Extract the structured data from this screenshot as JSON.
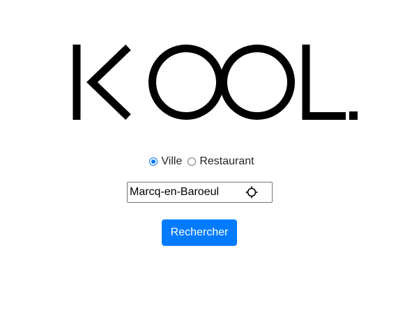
{
  "logo": {
    "text": "KOOL.",
    "color": "#000000"
  },
  "search_type": {
    "options": [
      {
        "label": "Ville",
        "checked": true
      },
      {
        "label": "Restaurant",
        "checked": false
      }
    ]
  },
  "search": {
    "value": "Marcq-en-Baroeul",
    "icon": "crosshair-locate-icon"
  },
  "submit": {
    "label": "Rechercher",
    "color": "#007bff"
  }
}
